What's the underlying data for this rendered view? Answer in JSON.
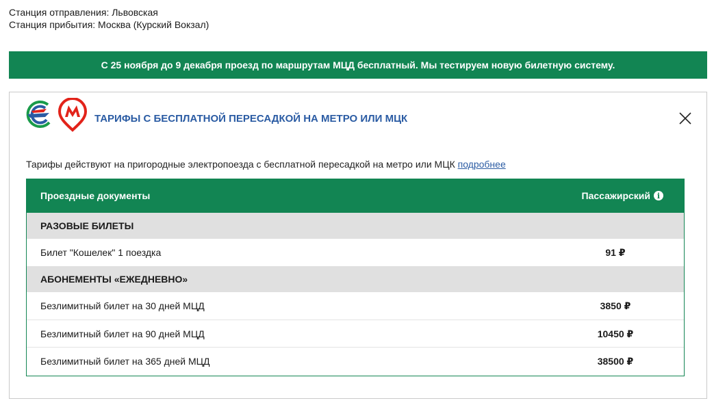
{
  "stations": {
    "departure": "Станция отправления: Львовская",
    "arrival": "Станция прибытия: Москва (Курский Вокзал)"
  },
  "banner": {
    "text": "С 25 ноября до 9 декабря проезд по маршрутам МЦД бесплатный. Мы тестируем новую билетную систему.",
    "color": "#128553"
  },
  "card": {
    "title": "ТАРИФЫ С БЕСПЛАТНОЙ ПЕРЕСАДКОЙ НА МЕТРО ИЛИ МЦК",
    "description": "Тарифы действуют на пригородные электропоезда с бесплатной пересадкой на метро или МЦК",
    "more_link": "подробнее",
    "icons": [
      "mcd-logo-icon",
      "metro-logo-icon",
      "close-icon",
      "info-icon"
    ]
  },
  "table": {
    "col_documents": "Проездные документы",
    "col_passenger": "Пассажирский",
    "sections": [
      {
        "title": "РАЗОВЫЕ БИЛЕТЫ",
        "items": [
          {
            "name": "Билет \"Кошелек\" 1 поездка",
            "price": "91 ₽"
          }
        ]
      },
      {
        "title": "АБОНЕМЕНТЫ «ЕЖЕДНЕВНО»",
        "items": [
          {
            "name": "Безлимитный билет на 30 дней МЦД",
            "price": "3850 ₽"
          },
          {
            "name": "Безлимитный билет на 90 дней МЦД",
            "price": "10450 ₽"
          },
          {
            "name": "Безлимитный билет на 365 дней МЦД",
            "price": "38500 ₽"
          }
        ]
      }
    ]
  }
}
